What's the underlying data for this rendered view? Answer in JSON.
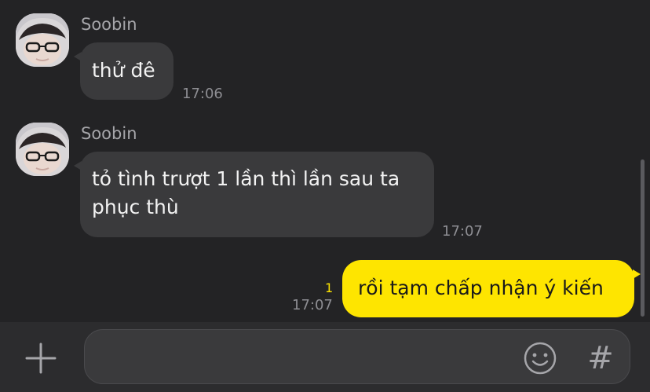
{
  "messages": [
    {
      "sender": "Soobin",
      "text": "thử đê",
      "time": "17:06"
    },
    {
      "sender": "Soobin",
      "text_lines": [
        "tỏ tình trượt 1 lần thì lần sau ta",
        "phục thù"
      ],
      "time": "17:07"
    },
    {
      "text": "rồi tạm chấp nhận ý kiến",
      "time": "17:07",
      "unread_count": "1"
    }
  ],
  "input": {
    "value": "",
    "placeholder": ""
  },
  "icons": {
    "attach": "plus-icon",
    "emoji": "emoji-icon",
    "hashtag": "hashtag-icon",
    "hashtag_glyph": "#"
  },
  "colors": {
    "background": "#232325",
    "incoming_bubble": "#3a3a3c",
    "outgoing_bubble": "#fee500",
    "unread": "#fee500"
  }
}
